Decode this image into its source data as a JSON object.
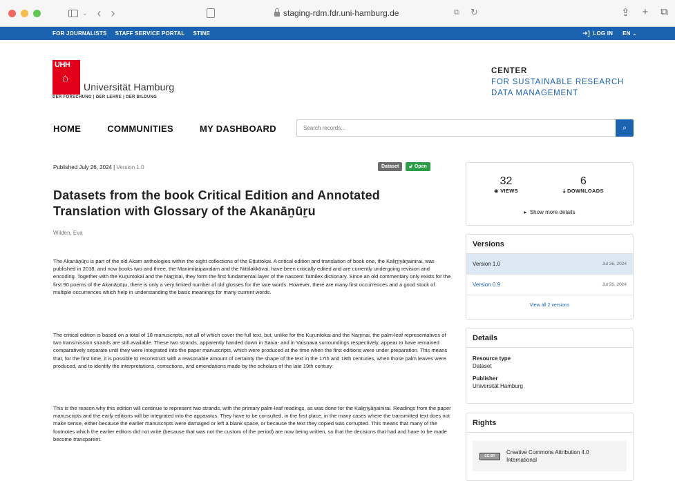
{
  "browser": {
    "url": "staging-rdm.fdr.uni-hamburg.de"
  },
  "topbar": {
    "links": [
      "FOR JOURNALISTS",
      "STAFF SERVICE PORTAL",
      "STINE"
    ],
    "login": "LOG IN",
    "language": "EN"
  },
  "header": {
    "logo_mark": "UHH",
    "university": "Universität Hamburg",
    "tagline": "DER FORSCHUNG | DER LEHRE | DER BILDUNG",
    "center_line1": "CENTER",
    "center_line2": "FOR SUSTAINABLE RESEARCH",
    "center_line3": "DATA MANAGEMENT"
  },
  "nav": {
    "items": [
      "HOME",
      "COMMUNITIES",
      "MY DASHBOARD"
    ],
    "search_placeholder": "Search records..."
  },
  "record": {
    "published": "Published July 26, 2024",
    "version": "Version 1.0",
    "badge_type": "Dataset",
    "badge_access": "Open",
    "title": "Datasets from the book Critical Edition and Annotated Translation with Glossary of the Akanāṉūṟu",
    "author": "Wilden, Eva",
    "paragraphs": [
      "The Akanāṉūṟu is part of the old Akam anthologies within the eight collections of the Eṭṭuttokai. A critical edition and translation of book one, the Kaḷiṟṟiyāṉainirai, was published in 2018, and now books two and three, the Manimiṭaipavaḷam and the Nittilakkōvai, have been critically edited and are currently undergoing revision and encoding. Together with the Kuṟuntokai and the Naṟṟiṇai, they form the first fundamental layer of the nascent Tamilex dictionary. Since an old commentary only exists for the first 90 poems of the Akanāṉūṟu, there is only a very limited number of old glosses for the rare words. However, there are many first occurrences and a good stock of multiple occurrences which help in understanding the basic meanings for many current words.",
      "The critical edition is based on a total of 18 manuscripts, not all of which cover the full text, but, unlike for the Kuṟuntokai and the Naṟṟiṇai, the palm-leaf representatives of two transmission strands are still available. These two strands, apparently handed down in Śaiva- and in Vaiṣṇava surroundings respectively, appear to have remained comparatively separate until they were integrated into the paper manuscripts, which were produced at the time when the first editions were under preparation. This means that, for the first time, it is possible to reconstruct with a reasonable amount of certainty the shape of the text in the 17th and 18th centuries, when those palm leaves were produced, and to identify the interpretations, corrections, and emendations made by the scholars of the late 19th century.",
      "This is the reason why this edition will continue to represent two strands, with the primary palm-leaf readings, as was done for the Kaḷiṟṟiyāṉainirai. Readings from the paper manuscripts and the early editions will be integrated into the apparatus. They have to be consulted, in the first place, in the many cases where the transmitted text does not make sense, either because the earlier manuscripts were damaged or left a blank space, or because the text they copied was corrupted. This means that many of the footnotes which the earlier editors did not write (because that was not the custom of the period) are now being written, so that the decisions that had and have to be made become transparent."
    ]
  },
  "sidebar": {
    "views_count": "32",
    "views_label": "VIEWS",
    "downloads_count": "6",
    "downloads_label": "DOWNLOADS",
    "more_details": "Show more details",
    "versions_title": "Versions",
    "versions": [
      {
        "label": "Version 1.0",
        "date": "Jul 26, 2024"
      },
      {
        "label": "Version 0.9",
        "date": "Jul 26, 2024"
      }
    ],
    "view_all": "View all 2 versions",
    "details_title": "Details",
    "resource_type_label": "Resource type",
    "resource_type": "Dataset",
    "publisher_label": "Publisher",
    "publisher": "Universität Hamburg",
    "rights_title": "Rights",
    "cc_badge": "CC BY",
    "license_line1": "Creative Commons Attribution 4.0",
    "license_line2": "International"
  },
  "colors": {
    "brand_blue": "#1b62b0",
    "uhh_red": "#e2001a",
    "open_green": "#2a9d46",
    "active_version_bg": "#dce8f4"
  }
}
